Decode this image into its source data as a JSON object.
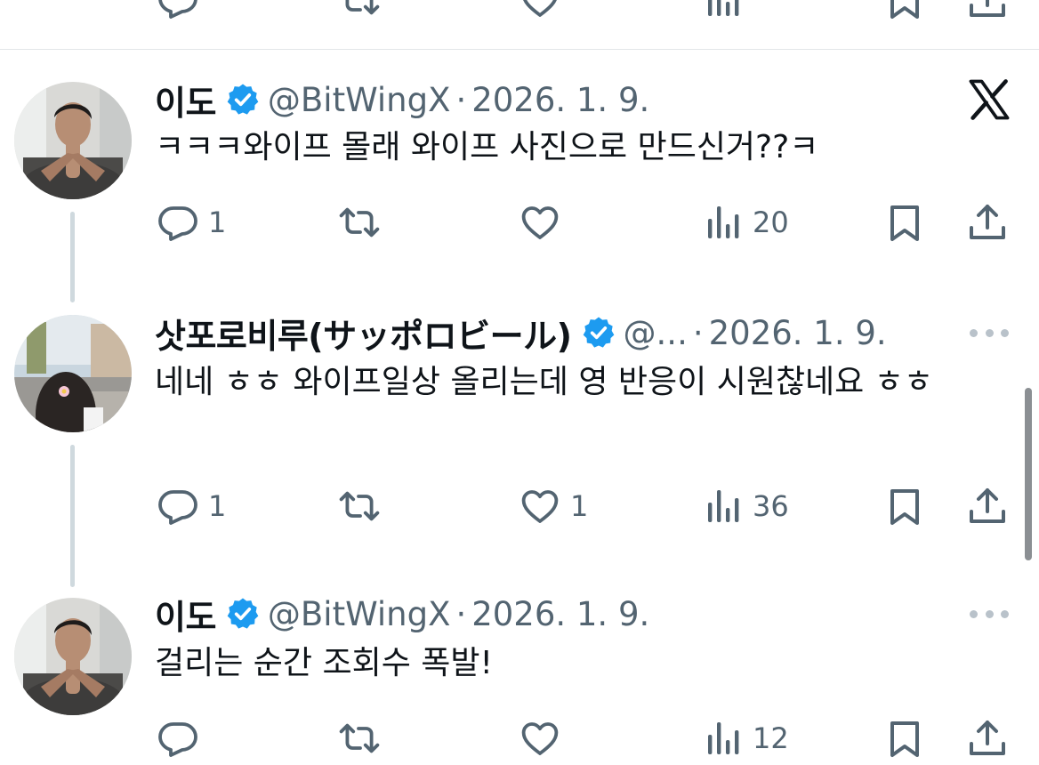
{
  "tweets": [
    {
      "name": "이도",
      "handle": "@BitWingX",
      "dot": "·",
      "date": "2026. 1. 9.",
      "text": "ㅋㅋㅋ와이프 몰래 와이프 사진으로 만드신거??ㅋ",
      "replies": "1",
      "likes": "",
      "views": "20"
    },
    {
      "name": "삿포로비루(サッポロビール)",
      "handle": "@...",
      "dot": "·",
      "date": "2026. 1. 9.",
      "text": "네네 ㅎㅎ 와이프일상 올리는데 영 반응이 시원찮네요 ㅎㅎ",
      "replies": "1",
      "likes": "1",
      "views": "36"
    },
    {
      "name": "이도",
      "handle": "@BitWingX",
      "dot": "·",
      "date": "2026. 1. 9.",
      "text": "걸리는 순간 조회수 폭발!",
      "replies": "",
      "likes": "",
      "views": "12"
    }
  ],
  "icons": {
    "verified": "verified-badge-icon",
    "reply": "reply-icon",
    "retweet": "retweet-icon",
    "like": "heart-icon",
    "views": "views-icon",
    "bookmark": "bookmark-icon",
    "share": "share-icon",
    "more": "more-icon",
    "x_logo": "x-logo-icon"
  },
  "colors": {
    "verified": "#1d9bf0",
    "text": "#0f1419",
    "secondary": "#536471",
    "thread_line": "#cfd9de"
  }
}
